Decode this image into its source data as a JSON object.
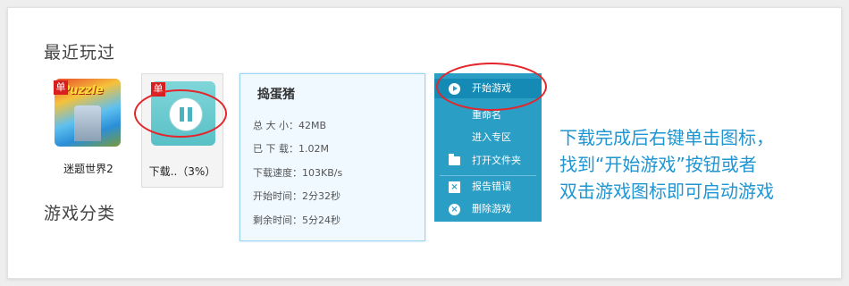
{
  "sections": {
    "recent_title": "最近玩过",
    "category_title": "游戏分类"
  },
  "games": [
    {
      "name": "迷题世界2",
      "badge": "单",
      "logo_text": "Puzzle"
    },
    {
      "name": "下载..（3%）",
      "badge": "单",
      "status": "paused-download"
    }
  ],
  "download_info": {
    "title": "捣蛋猪",
    "rows": [
      "总 大 小：42MB",
      "已 下 载：1.02M",
      "下载速度：103KB/s",
      "开始时间：2分32秒",
      "剩余时间：5分24秒"
    ]
  },
  "context_menu": {
    "items": [
      {
        "label": "开始游戏",
        "icon": "play-icon"
      },
      {
        "label": "重命名",
        "icon": ""
      },
      {
        "label": "进入专区",
        "icon": ""
      },
      {
        "label": "打开文件夹",
        "icon": "folder-icon"
      },
      {
        "label": "报告错误",
        "icon": "report-icon"
      },
      {
        "label": "删除游戏",
        "icon": "delete-icon"
      }
    ]
  },
  "instruction": {
    "line1": "下载完成后右键单击图标，",
    "line2": "找到“开始游戏”按钮或者",
    "line3": "双击游戏图标即可启动游戏"
  },
  "colors": {
    "menu_bg": "#2b9ec5",
    "accent_text": "#1f95d2",
    "highlight_ring": "#e3262b",
    "badge_red": "#d81e1e"
  }
}
